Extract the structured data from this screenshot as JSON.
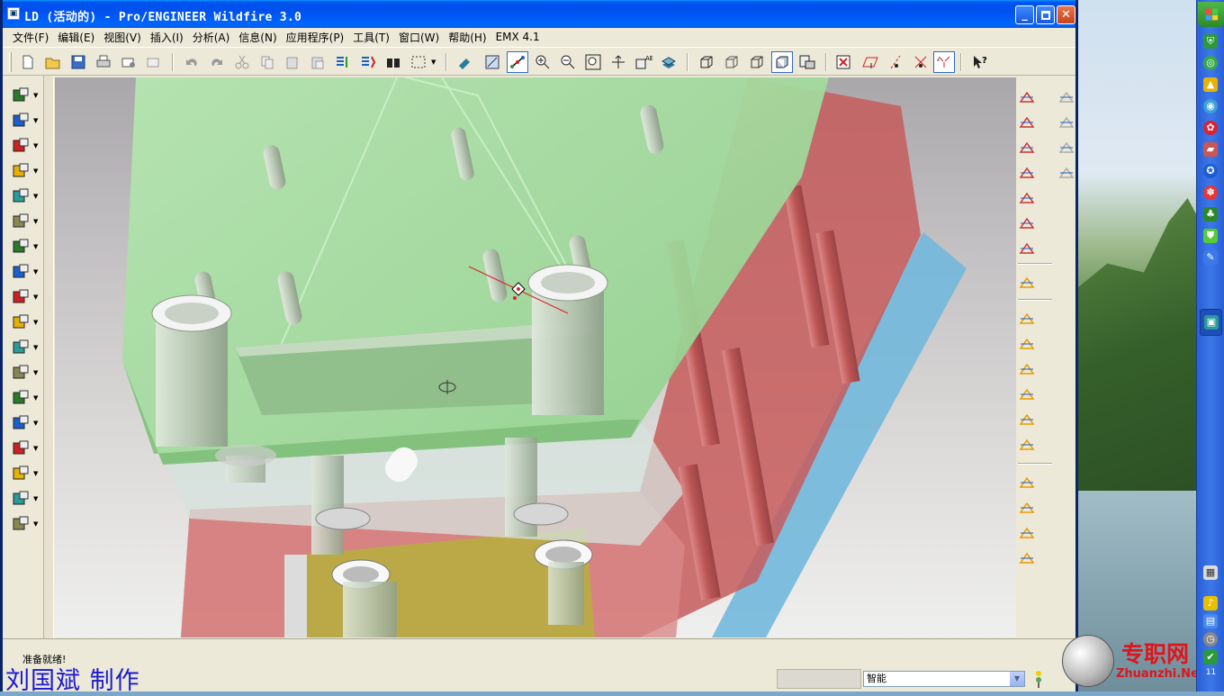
{
  "window": {
    "title": "LD (活动的) - Pro/ENGINEER Wildfire 3.0",
    "icon_name": "proe-app-icon"
  },
  "menu": [
    {
      "label": "文件(F)"
    },
    {
      "label": "编辑(E)"
    },
    {
      "label": "视图(V)"
    },
    {
      "label": "插入(I)"
    },
    {
      "label": "分析(A)"
    },
    {
      "label": "信息(N)"
    },
    {
      "label": "应用程序(P)"
    },
    {
      "label": "工具(T)"
    },
    {
      "label": "窗口(W)"
    },
    {
      "label": "帮助(H)"
    },
    {
      "label": "EMX 4.1"
    }
  ],
  "toolbar": {
    "icons": [
      "new-icon",
      "open-icon",
      "save-icon",
      "print-icon",
      "send-mail-icon",
      "mail-icon",
      "undo-icon",
      "redo-icon",
      "cut-icon",
      "copy-icon",
      "paste-icon",
      "paste-special-icon",
      "regenerate-icon",
      "regen-manager-icon",
      "find-icon",
      "select-box-icon",
      "repaint-icon",
      "orient-icon",
      "spin-center-icon",
      "zoom-in-icon",
      "zoom-out-icon",
      "refit-icon",
      "reorient-icon",
      "saved-views-icon",
      "layers-icon",
      "wireframe-icon",
      "hidden-line-icon",
      "no-hidden-icon",
      "shading-icon",
      "model-tree-icon",
      "close-window-icon",
      "datum-planes-icon",
      "datum-axes-icon",
      "datum-points-icon",
      "coord-sys-icon",
      "whats-this-icon"
    ]
  },
  "left_toolbar": {
    "icons": [
      "emx-new-icon",
      "emx-assembly-icon",
      "emx-ejector-icon",
      "emx-screw-icon",
      "emx-pin-icon",
      "emx-guide-icon",
      "emx-sprue-icon",
      "emx-plate-icon",
      "emx-slider-icon",
      "emx-lifter-icon",
      "emx-cooling-icon",
      "emx-component-icon",
      "emx-edit-icon",
      "emx-delete-icon",
      "emx-bom-icon",
      "emx-drawing-icon",
      "emx-settings-icon",
      "emx-info-icon"
    ]
  },
  "right_toolbar": {
    "icons": [
      "sketch-point-icon",
      "datum-curve-icon",
      "datum-plane-icon",
      "datum-axis-icon",
      "sketched-curve-icon",
      "datum-point-icon",
      "coordinate-system-icon",
      "analysis-icon",
      "extrude-icon",
      "revolve-icon",
      "sweep-icon",
      "blend-icon",
      "round-icon",
      "chamfer-icon",
      "pattern-icon",
      "mirror-icon",
      "draft-icon",
      "shell-icon",
      "trim-icon",
      "merge-icon",
      "offset-icon",
      "thicken-icon"
    ]
  },
  "status": {
    "message": "准备就绪!",
    "filter_value": "智能",
    "author_caption": "刘国斌 制作"
  },
  "watermark": {
    "title": "专职网",
    "url": "Zhuanzhi.Net"
  },
  "taskbar": {
    "clock": "11"
  },
  "colors": {
    "title_bar": "#0053ee",
    "plate_green": "#9fdc9a",
    "plate_red": "#c45656",
    "plate_blue": "#6fb4d6",
    "plate_yellow": "#b7a844",
    "author_text": "#1b1ad0",
    "watermark_text": "#e0141b"
  }
}
